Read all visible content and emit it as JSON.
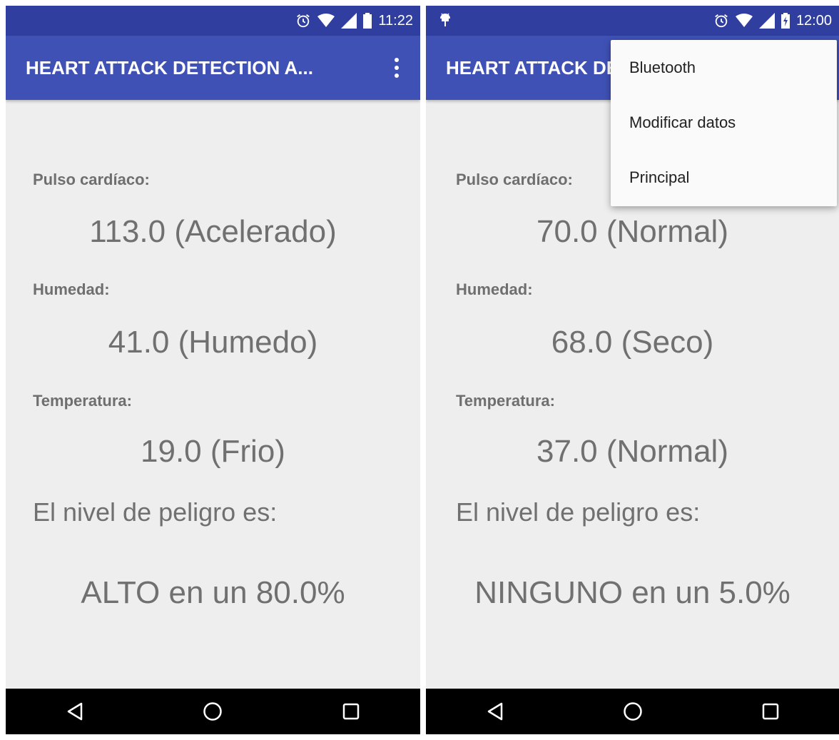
{
  "screens": [
    {
      "status_time": "11:22",
      "app_title": "HEART ATTACK DETECTION A...",
      "pulse_label": "Pulso cardíaco:",
      "pulse_value": "113.0 (Acelerado)",
      "humidity_label": "Humedad:",
      "humidity_value": "41.0 (Humedo)",
      "temp_label": "Temperatura:",
      "temp_value": "19.0 (Frio)",
      "danger_label": "El nivel de peligro es:",
      "danger_value": "ALTO en un 80.0%"
    },
    {
      "status_time": "12:00",
      "app_title": "HEART ATTACK DETECTION A...",
      "pulse_label": "Pulso cardíaco:",
      "pulse_value": "70.0 (Normal)",
      "humidity_label": "Humedad:",
      "humidity_value": "68.0 (Seco)",
      "temp_label": "Temperatura:",
      "temp_value": "37.0 (Normal)",
      "danger_label": "El nivel de peligro es:",
      "danger_value": "NINGUNO en un 5.0%",
      "menu": {
        "items": [
          "Bluetooth",
          "Modificar datos",
          "Principal"
        ]
      }
    }
  ],
  "colors": {
    "status_bar": "#303f9f",
    "app_bar": "#3f51b5",
    "background": "#eeeeee",
    "text_gray": "#707070"
  },
  "icons": [
    "alarm-icon",
    "wifi-icon",
    "signal-icon",
    "battery-icon",
    "battery-charging-icon",
    "android-debug-icon",
    "overflow-menu-icon",
    "back-icon",
    "home-icon",
    "recents-icon"
  ]
}
